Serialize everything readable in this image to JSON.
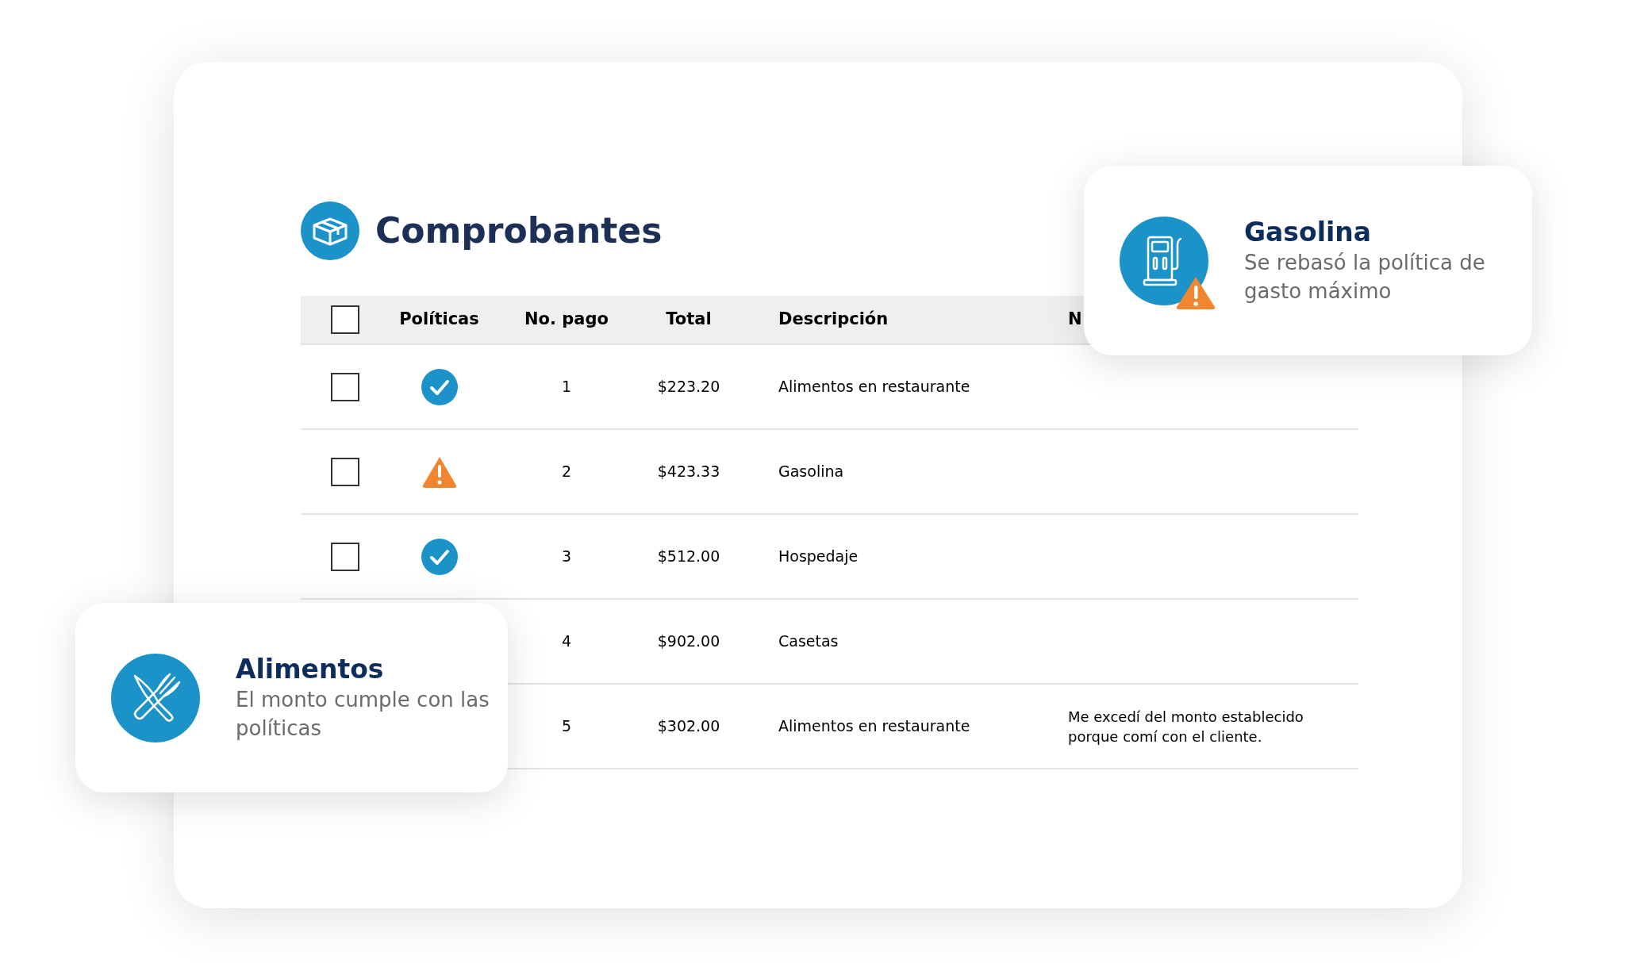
{
  "title": "Comprobantes",
  "table": {
    "select_all": {
      "checked": false
    },
    "columns": [
      "Políticas",
      "No. pago",
      "Total",
      "Descripción",
      "N"
    ],
    "rows": [
      {
        "checked": false,
        "warning": false,
        "no_pago": "1",
        "total": "$223.20",
        "descripcion": "Alimentos en restaurante"
      },
      {
        "checked": false,
        "warning": true,
        "no_pago": "2",
        "total": "$423.33",
        "descripcion": "Gasolina"
      },
      {
        "checked": false,
        "warning": false,
        "no_pago": "3",
        "total": "$512.00",
        "descripcion": "Hospedaje"
      },
      {
        "no_pago": "4",
        "total": "$902.00",
        "descripcion": "Casetas"
      },
      {
        "no_pago": "5",
        "total": "$302.00",
        "descripcion": "Alimentos en restaurante",
        "notes": "Me excedí del monto establecido porque comí con el cliente."
      }
    ]
  },
  "popups": [
    {
      "kind": "fuel",
      "warning": true,
      "title": "Gasolina",
      "message": "Se rebasó la política de gasto máximo"
    },
    {
      "kind": "food",
      "warning": false,
      "title": "Alimentos",
      "message": "El monto cumple con las políticas"
    }
  ]
}
